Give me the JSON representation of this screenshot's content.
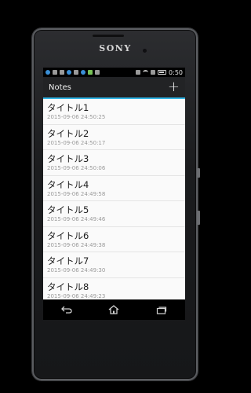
{
  "device": {
    "brand": "SONY"
  },
  "status": {
    "time": "0:50"
  },
  "actionbar": {
    "title": "Notes",
    "add_label": "+"
  },
  "notes": [
    {
      "title": "タイトル1",
      "date": "2015-09-06 24:50:25"
    },
    {
      "title": "タイトル2",
      "date": "2015-09-06 24:50:17"
    },
    {
      "title": "タイトル3",
      "date": "2015-09-06 24:50:06"
    },
    {
      "title": "タイトル4",
      "date": "2015-09-06 24:49:58"
    },
    {
      "title": "タイトル5",
      "date": "2015-09-06 24:49:46"
    },
    {
      "title": "タイトル6",
      "date": "2015-09-06 24:49:38"
    },
    {
      "title": "タイトル7",
      "date": "2015-09-06 24:49:30"
    },
    {
      "title": "タイトル8",
      "date": "2015-09-06 24:49:23"
    }
  ],
  "nav": {
    "back": "back-icon",
    "home": "home-icon",
    "recents": "recents-icon"
  },
  "colors": {
    "accent": "#33b5e5",
    "actionbar": "#222325",
    "list_bg": "#fafafa"
  }
}
